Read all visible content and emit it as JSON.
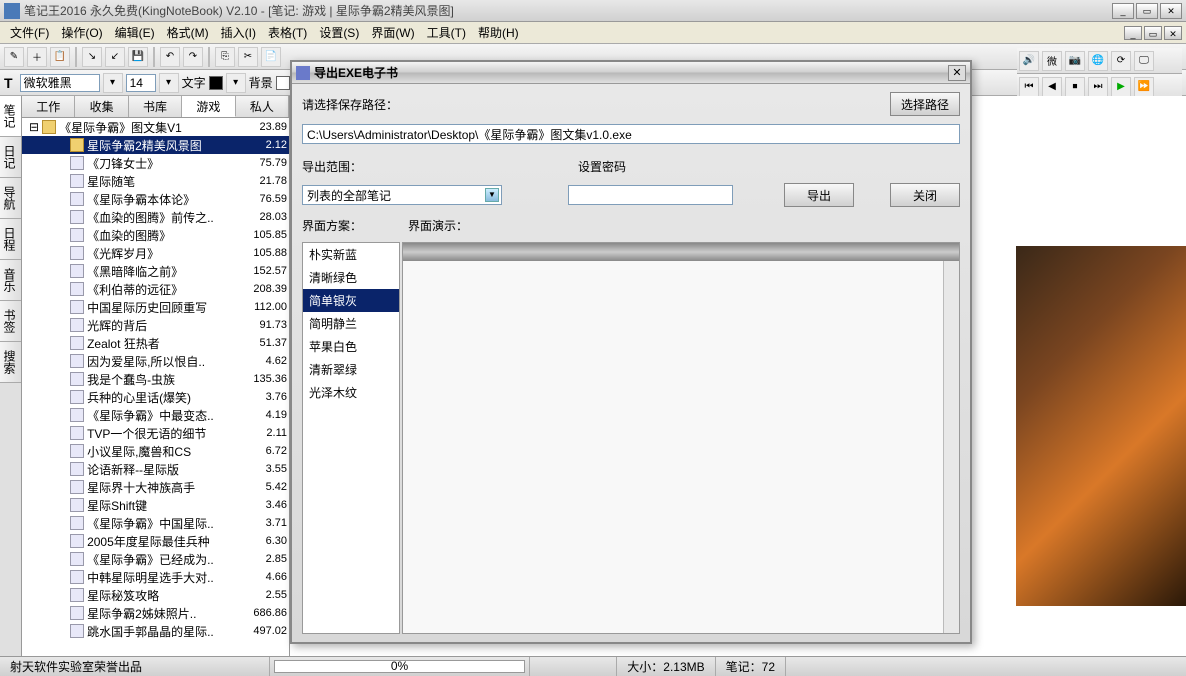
{
  "title": "笔记王2016 永久免费(KingNoteBook) V2.10 - [笔记: 游戏 | 星际争霸2精美风景图]",
  "menu": [
    "文件(F)",
    "操作(O)",
    "编辑(E)",
    "格式(M)",
    "插入(I)",
    "表格(T)",
    "设置(S)",
    "界面(W)",
    "工具(T)",
    "帮助(H)"
  ],
  "format": {
    "font_family": "微软雅黑",
    "font_size": "14",
    "text_label": "文字",
    "text_color": "#000000",
    "bg_label": "背景",
    "bg_color": "#ffffff"
  },
  "side_tabs": [
    "笔记",
    "日记",
    "导航",
    "日程",
    "音乐",
    "书签",
    "搜索"
  ],
  "tree_tabs": [
    "工作",
    "收集",
    "书库",
    "游戏",
    "私人"
  ],
  "tree_tabs_active": 3,
  "tree_root": {
    "label": "《星际争霸》图文集V1",
    "size": "23.89"
  },
  "tree_items": [
    {
      "label": "星际争霸2精美风景图",
      "size": "2.12",
      "selected": true,
      "icon": "folder"
    },
    {
      "label": "《刀锋女士》",
      "size": "75.79"
    },
    {
      "label": "星际随笔",
      "size": "21.78"
    },
    {
      "label": "《星际争霸本体论》",
      "size": "76.59"
    },
    {
      "label": "《血染的图腾》前传之..",
      "size": "28.03"
    },
    {
      "label": "《血染的图腾》",
      "size": "105.85"
    },
    {
      "label": "《光辉岁月》",
      "size": "105.88"
    },
    {
      "label": "《黑暗降临之前》",
      "size": "152.57"
    },
    {
      "label": "《利伯蒂的远征》",
      "size": "208.39"
    },
    {
      "label": "中国星际历史回顾重写",
      "size": "112.00"
    },
    {
      "label": "光辉的背后",
      "size": "91.73"
    },
    {
      "label": "Zealot 狂热者",
      "size": "51.37"
    },
    {
      "label": "因为爱星际,所以恨自..",
      "size": "4.62"
    },
    {
      "label": "我是个蠢鸟-虫族",
      "size": "135.36"
    },
    {
      "label": "兵种的心里话(爆笑)",
      "size": "3.76"
    },
    {
      "label": "《星际争霸》中最变态..",
      "size": "4.19"
    },
    {
      "label": "TVP一个很无语的细节",
      "size": "2.11"
    },
    {
      "label": "小议星际,魔兽和CS",
      "size": "6.72"
    },
    {
      "label": "论语新释--星际版",
      "size": "3.55"
    },
    {
      "label": "星际界十大神族高手",
      "size": "5.42"
    },
    {
      "label": "星际Shift键",
      "size": "3.46"
    },
    {
      "label": "《星际争霸》中国星际..",
      "size": "3.71"
    },
    {
      "label": "2005年度星际最佳兵种",
      "size": "6.30"
    },
    {
      "label": "《星际争霸》已经成为..",
      "size": "2.85"
    },
    {
      "label": "中韩星际明星选手大对..",
      "size": "4.66"
    },
    {
      "label": "星际秘笈攻略",
      "size": "2.55"
    },
    {
      "label": "星际争霸2姊妹照片..",
      "size": "686.86"
    },
    {
      "label": "跳水国手郭晶晶的星际..",
      "size": "497.02"
    }
  ],
  "dialog": {
    "title": "导出EXE电子书",
    "path_label": "请选择保存路径：",
    "path_value": "C:\\Users\\Administrator\\Desktop\\《星际争霸》图文集v1.0.exe",
    "browse_btn": "选择路径",
    "scope_label": "导出范围：",
    "scope_value": "列表的全部笔记",
    "password_label": "设置密码",
    "export_btn": "导出",
    "close_btn": "关闭",
    "theme_label": "界面方案：",
    "preview_label": "界面演示：",
    "themes": [
      "朴实新蓝",
      "清晰绿色",
      "简单银灰",
      "简明静兰",
      "苹果白色",
      "清新翠绿",
      "光泽木纹"
    ],
    "theme_selected": 2
  },
  "status": {
    "vendor": "射天软件实验室荣誉出品",
    "progress": "0%",
    "size_label": "大小：",
    "size_value": "2.13MB",
    "notes_label": "笔记：",
    "notes_value": "72"
  }
}
